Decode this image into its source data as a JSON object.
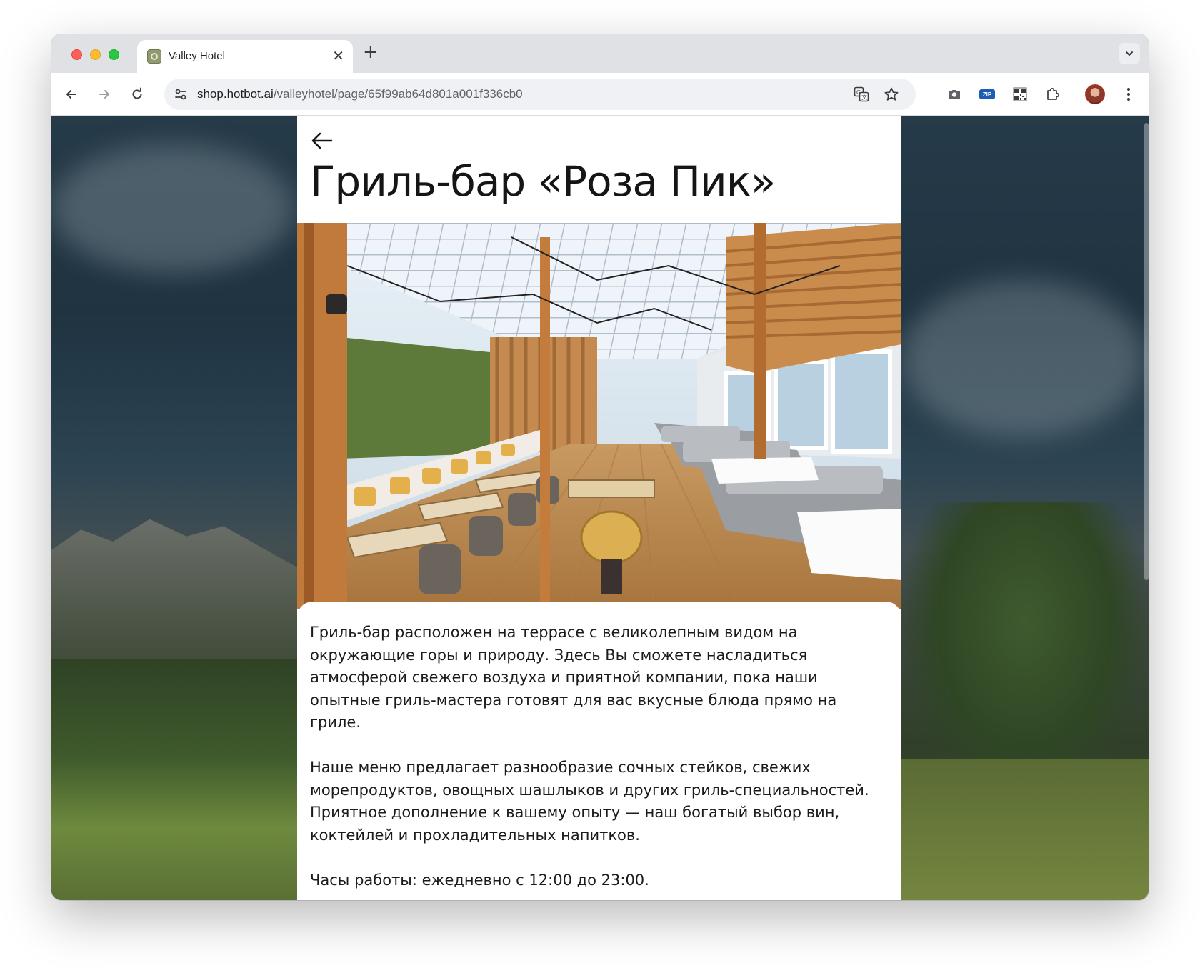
{
  "browser": {
    "tab_title": "Valley Hotel",
    "url_host": "shop.hotbot.ai",
    "url_path": "/valleyhotel/page/65f99ab64d801a001f336cb0",
    "zip_label": "ZIP"
  },
  "page": {
    "title": "Гриль-бар «Роза Пик»",
    "paragraphs": [
      "Гриль-бар расположен на террасе с великолепным видом на окружающие горы и природу. Здесь Вы сможете насладиться атмосферой свежего воздуха и приятной компании, пока наши опытные гриль-мастера готовят для вас вкусные блюда прямо на гриле.",
      "Наше меню предлагает разнообразие сочных стейков, свежих морепродуктов, овощных шашлыков и других гриль-специальностей. Приятное дополнение к вашему опыту — наш богатый выбор вин, коктейлей и прохладительных напитков.",
      "Часы работы: ежедневно с 12:00 до 23:00."
    ]
  },
  "icons": {
    "back": "back-arrow-icon",
    "forward": "forward-arrow-icon",
    "reload": "reload-icon",
    "site_info": "tune-icon",
    "translate": "translate-icon",
    "bookmark": "star-icon",
    "screenshot": "camera-icon",
    "zip": "zip-icon",
    "qr": "qr-code-icon",
    "extensions": "puzzle-icon",
    "menu": "kebab-menu-icon"
  },
  "colors": {
    "traffic_red": "#ff5f57",
    "traffic_yellow": "#febc2e",
    "traffic_green": "#28c840",
    "panel_bg": "#ffffff",
    "text": "#1b1b1b"
  }
}
